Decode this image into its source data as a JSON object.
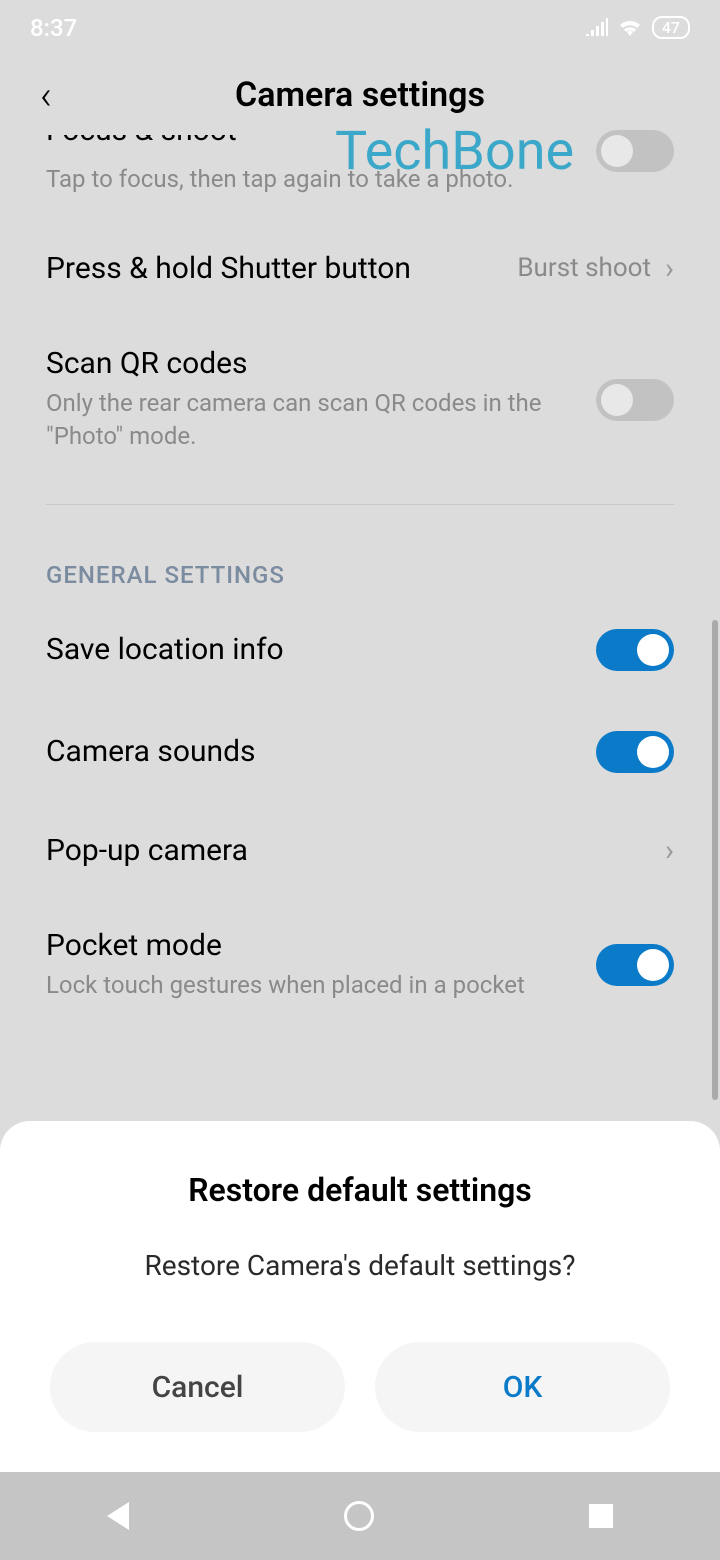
{
  "status": {
    "time": "8:37",
    "battery": "47"
  },
  "header": {
    "title": "Camera settings"
  },
  "watermark": "TechBone",
  "settings": {
    "focus_shoot": {
      "sub": "Tap to focus, then tap again to take a photo."
    },
    "press_hold": {
      "title": "Press & hold Shutter button",
      "value": "Burst shoot"
    },
    "scan_qr": {
      "title": "Scan QR codes",
      "sub": "Only the rear camera can scan QR codes in the \"Photo\" mode."
    },
    "section_general": "GENERAL SETTINGS",
    "save_location": {
      "title": "Save location info"
    },
    "camera_sounds": {
      "title": "Camera sounds"
    },
    "popup_camera": {
      "title": "Pop-up camera"
    },
    "pocket_mode": {
      "title": "Pocket mode",
      "sub": "Lock touch gestures when placed in a pocket"
    }
  },
  "dialog": {
    "title": "Restore default settings",
    "message": "Restore Camera's default settings?",
    "cancel": "Cancel",
    "ok": "OK"
  }
}
